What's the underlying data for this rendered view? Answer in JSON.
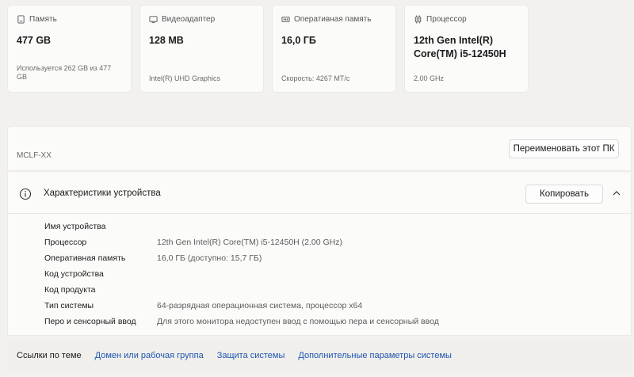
{
  "cards": [
    {
      "icon": "storage-icon",
      "label": "Память",
      "value": "477 GB",
      "sub": "Используется 262 GB из 477 GB"
    },
    {
      "icon": "display-adapter-icon",
      "label": "Видеоадаптер",
      "value": "128 MB",
      "sub": "Intel(R) UHD Graphics"
    },
    {
      "icon": "ram-icon",
      "label": "Оперативная память",
      "value": "16,0 ГБ",
      "sub": "Скорость: 4267 МТ/с"
    },
    {
      "icon": "processor-icon",
      "label": "Процессор",
      "value": "12th Gen Intel(R) Core(TM) i5-12450H",
      "sub": "2.00 GHz"
    }
  ],
  "pc": {
    "name": "MCLF-XX",
    "rename_label": "Переименовать этот ПК"
  },
  "specs": {
    "title": "Характеристики устройства",
    "copy_label": "Копировать",
    "rows": [
      {
        "label": "Имя устройства",
        "value": ""
      },
      {
        "label": "Процессор",
        "value": "12th Gen Intel(R) Core(TM) i5-12450H (2.00 GHz)"
      },
      {
        "label": "Оперативная память",
        "value": "16,0 ГБ (доступно: 15,7 ГБ)"
      },
      {
        "label": "Код устройства",
        "value": ""
      },
      {
        "label": "Код продукта",
        "value": ""
      },
      {
        "label": "Тип системы",
        "value": "64-разрядная операционная система, процессор x64"
      },
      {
        "label": "Перо и сенсорный ввод",
        "value": "Для этого монитора недоступен ввод с помощью пера и сенсорный ввод"
      }
    ]
  },
  "related": {
    "label": "Ссылки по теме",
    "links": [
      "Домен или рабочая группа",
      "Защита системы",
      "Дополнительные параметры системы"
    ]
  },
  "colors": {
    "link": "#1c56b3",
    "background": "#f3f1ef",
    "card": "#fbfbfa"
  }
}
